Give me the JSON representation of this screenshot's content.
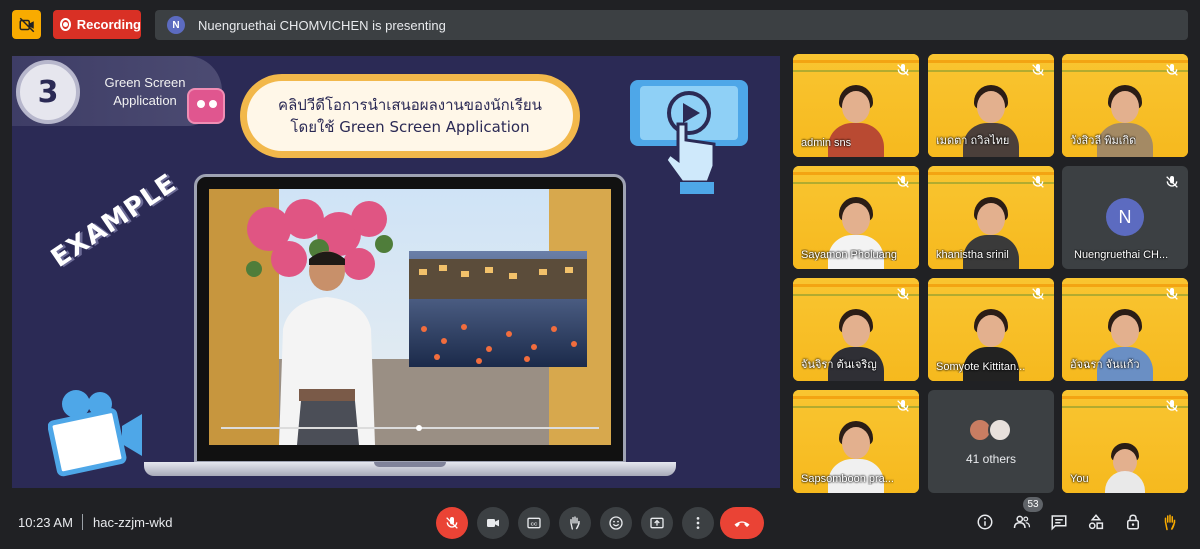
{
  "top_bar": {
    "camera_off_icon": "video-off-icon",
    "recording_label": "Recording",
    "presenter_initial": "N",
    "presenting_text": "Nuengruethai CHOMVICHEN is presenting"
  },
  "slide": {
    "step_number": "3",
    "step_title": "Green Screen Application",
    "title_line1": "คลิปวีดีโอการนำเสนอผลงานของนักเรียน",
    "title_line2": "โดยใช้ Green Screen Application",
    "example_label": "EXAMPLE"
  },
  "participants": [
    {
      "name": "admin sns",
      "type": "video",
      "muted": true
    },
    {
      "name": "เมดตา ถวิลไทย",
      "type": "video",
      "muted": true
    },
    {
      "name": "วังสิวลี พิมเกิด",
      "type": "video",
      "muted": true
    },
    {
      "name": "Sayamon Pholuang",
      "type": "video",
      "muted": true
    },
    {
      "name": "khanistha srinil",
      "type": "video",
      "muted": true
    },
    {
      "name": "Nuengruethai CH...",
      "type": "avatar",
      "initial": "N",
      "muted": true
    },
    {
      "name": "จันจิรา ต้นเจริญ",
      "type": "video",
      "muted": true
    },
    {
      "name": "Somyote Kittitan...",
      "type": "video",
      "muted": true
    },
    {
      "name": "อัจฉรา จันแก้ว",
      "type": "video",
      "muted": true
    },
    {
      "name": "Sapsomboon pra...",
      "type": "video",
      "muted": true
    },
    {
      "name": "41 others",
      "type": "others"
    },
    {
      "name": "You",
      "type": "video",
      "muted": true
    }
  ],
  "bottom_bar": {
    "time": "10:23 AM",
    "meeting_code": "hac-zzjm-wkd",
    "participant_count": "53",
    "controls": [
      "mic-off-icon",
      "camera-icon",
      "captions-icon",
      "raise-hand-icon",
      "emoji-icon",
      "present-icon",
      "more-options-icon",
      "end-call-icon"
    ],
    "right_icons": [
      "info-icon",
      "people-icon",
      "chat-icon",
      "activities-icon",
      "host-controls-icon",
      "hand-icon"
    ]
  },
  "colors": {
    "accent_red": "#ea4335",
    "tile_yellow": "#fbc02d",
    "slide_bg": "#2b2a55",
    "avatar_purple": "#5c6bc0"
  }
}
